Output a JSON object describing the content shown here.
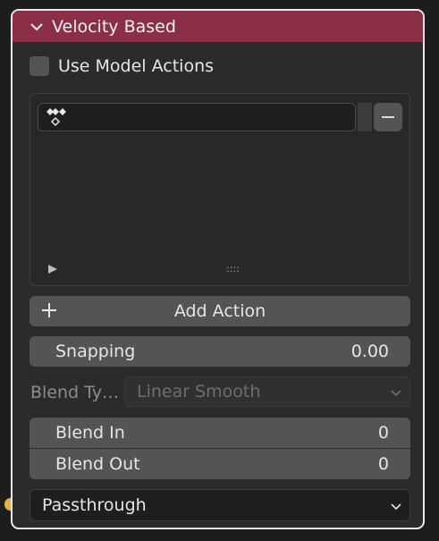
{
  "node": {
    "title": "Velocity Based",
    "header_color": "#8b2f46"
  },
  "use_model_actions": {
    "label": "Use Model Actions",
    "checked": false
  },
  "action_list": {
    "items": [
      {
        "name": "",
        "icon": "action-diamond-icon"
      }
    ],
    "remove_icon": "minus-icon",
    "expand_icon": "play-triangle-icon",
    "resize_grip": "::::"
  },
  "add_action": {
    "label": "Add Action",
    "icon": "plus-icon"
  },
  "snapping": {
    "label": "Snapping",
    "value": "0.00"
  },
  "blend_type": {
    "label": "Blend Ty…",
    "value": "Linear Smooth",
    "disabled": true
  },
  "blend_in": {
    "label": "Blend In",
    "value": "0"
  },
  "blend_out": {
    "label": "Blend Out",
    "value": "0"
  },
  "output": {
    "value": "Passthrough",
    "socket_color": "#e8b13a"
  }
}
